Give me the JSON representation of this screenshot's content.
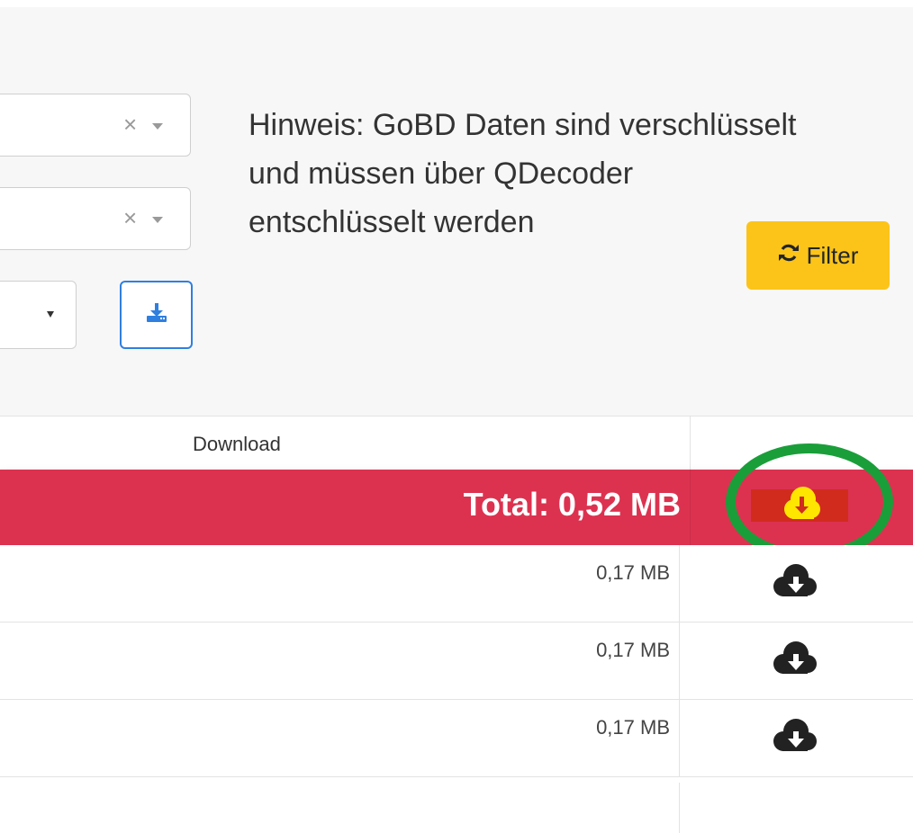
{
  "filters": {
    "select1_clear": "×",
    "select2_clear": "×",
    "export_button_icon": "download-tray-icon",
    "hint_lines": [
      "Hinweis: GoBD Daten sind verschlüsselt",
      "und müssen über QDecoder",
      "entschlüsselt werden"
    ],
    "filter_button_label": "Filter",
    "filter_button_icon": "refresh-icon"
  },
  "table": {
    "download_header": "Download",
    "total_label": "Total: 0,52 MB",
    "total_download_icon": "cloud-download-icon",
    "rows": [
      {
        "size": "0,17 MB",
        "icon": "cloud-download-icon"
      },
      {
        "size": "0,17 MB",
        "icon": "cloud-download-icon"
      },
      {
        "size": "0,17 MB",
        "icon": "cloud-download-icon"
      }
    ]
  },
  "colors": {
    "total_row_bg": "#dc3250",
    "filter_button_bg": "#fcc419",
    "export_button_border": "#2f7fe0",
    "highlight_ring": "#1a9e3a",
    "total_icon_fill": "#ffe600",
    "total_icon_mark": "#d12b1e"
  }
}
